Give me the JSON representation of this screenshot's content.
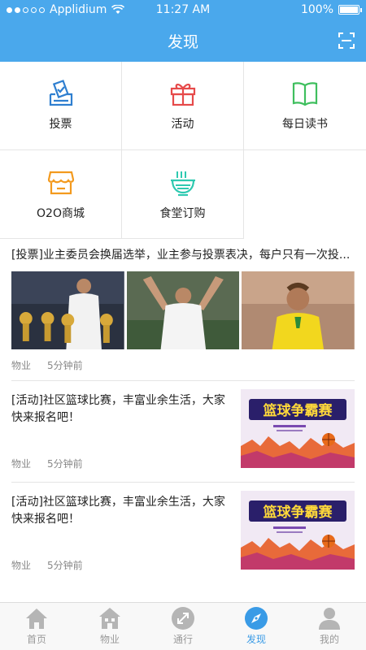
{
  "status": {
    "carrier": "Applidium",
    "time": "11:27 AM",
    "battery": "100%"
  },
  "nav": {
    "title": "发现"
  },
  "grid": [
    {
      "label": "投票",
      "icon": "vote-icon",
      "color": "#2f7fd0"
    },
    {
      "label": "活动",
      "icon": "gift-icon",
      "color": "#e64a4a"
    },
    {
      "label": "每日读书",
      "icon": "book-icon",
      "color": "#3fbf5e"
    },
    {
      "label": "O2O商城",
      "icon": "shop-icon",
      "color": "#f39a1e"
    },
    {
      "label": "食堂订购",
      "icon": "bowl-icon",
      "color": "#2ec9b0"
    }
  ],
  "feed": {
    "vote": {
      "title": "[投票]业主委员会换届选举，业主参与投票表决，每户只有一次投...",
      "source": "物业",
      "time": "5分钟前"
    },
    "items": [
      {
        "text": "[活动]社区篮球比赛，丰富业余生活，大家快来报名吧！",
        "source": "物业",
        "time": "5分钟前",
        "poster": "篮球争霸赛"
      },
      {
        "text": "[活动]社区篮球比赛，丰富业余生活，大家快来报名吧！",
        "source": "物业",
        "time": "5分钟前",
        "poster": "篮球争霸赛"
      }
    ]
  },
  "tabs": [
    {
      "label": "首页",
      "icon": "home-icon"
    },
    {
      "label": "物业",
      "icon": "property-icon"
    },
    {
      "label": "通行",
      "icon": "pass-icon"
    },
    {
      "label": "发现",
      "icon": "compass-icon",
      "active": true
    },
    {
      "label": "我的",
      "icon": "user-icon"
    }
  ],
  "colors": {
    "primary": "#4aa8ec",
    "tab_active": "#3a9be6"
  }
}
